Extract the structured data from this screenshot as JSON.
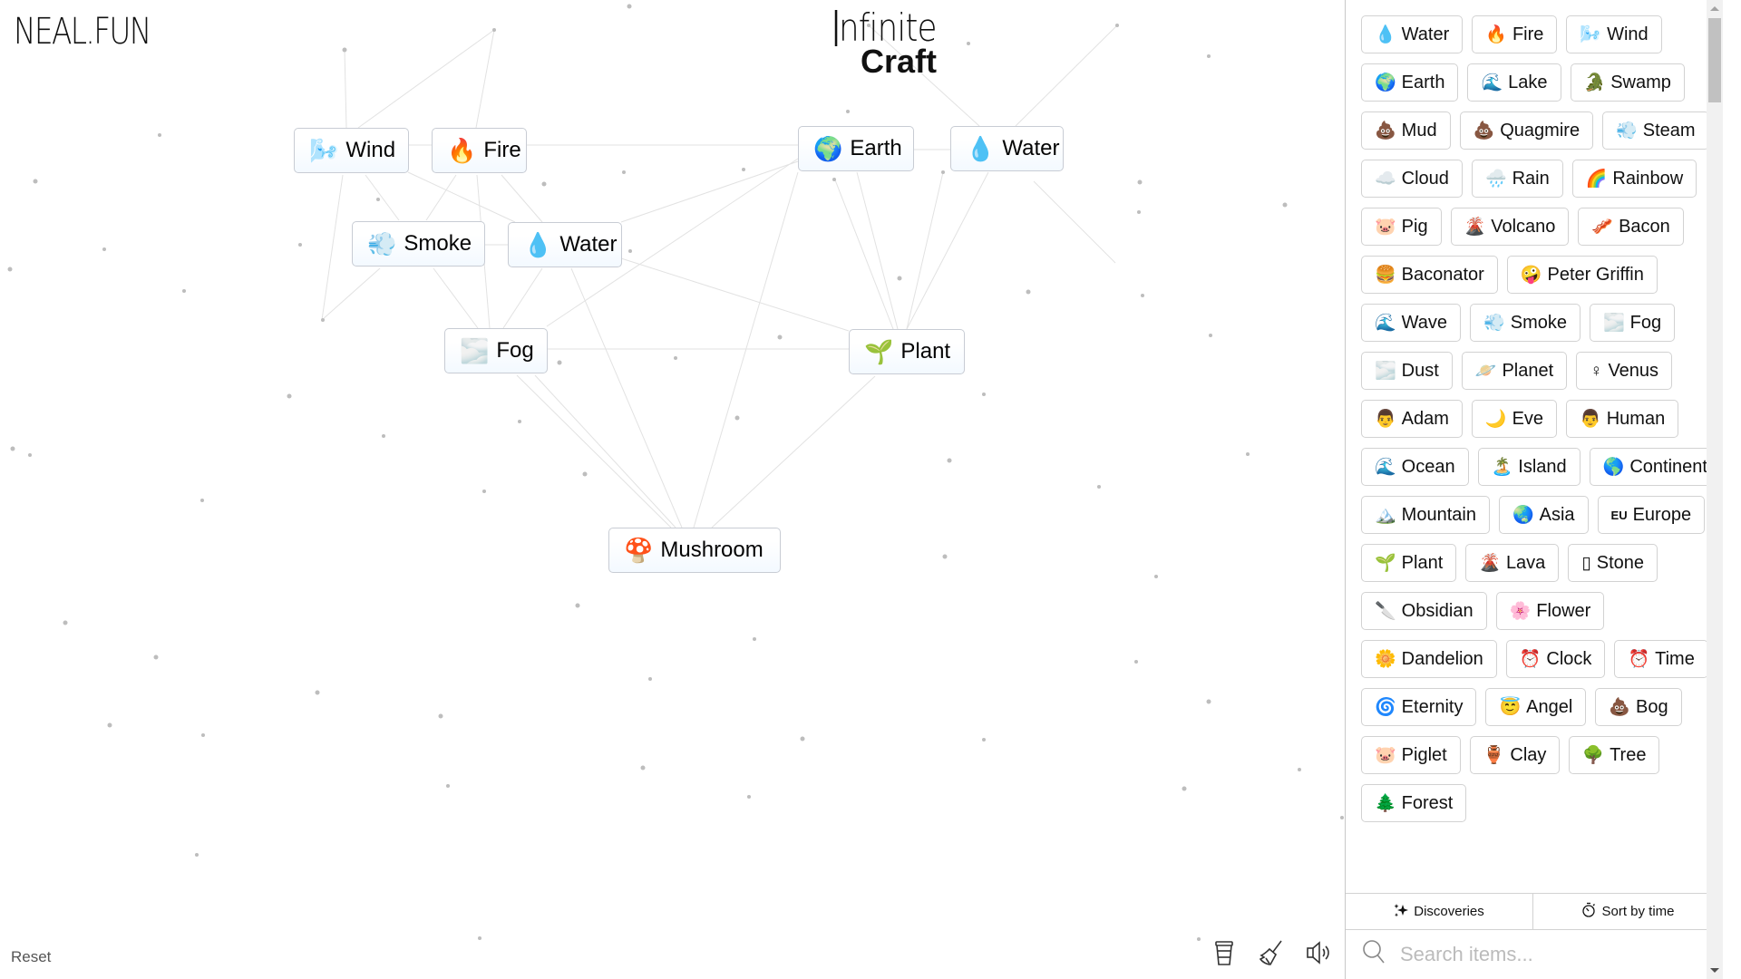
{
  "header": {
    "logo": "NEAL.FUN",
    "title_line1": "nfinite",
    "title_line2": "Craft"
  },
  "canvas": {
    "items": [
      {
        "id": "wind",
        "emoji": "🌬️",
        "label": "Wind"
      },
      {
        "id": "fire",
        "emoji": "🔥",
        "label": "Fire"
      },
      {
        "id": "smoke",
        "emoji": "💨",
        "label": "Smoke"
      },
      {
        "id": "water1",
        "emoji": "💧",
        "label": "Water"
      },
      {
        "id": "fog",
        "emoji": "🌫️",
        "label": "Fog"
      },
      {
        "id": "earth",
        "emoji": "🌍",
        "label": "Earth"
      },
      {
        "id": "water2",
        "emoji": "💧",
        "label": "Water"
      },
      {
        "id": "plant",
        "emoji": "🌱",
        "label": "Plant"
      },
      {
        "id": "mushroom",
        "emoji": "🍄",
        "label": "Mushroom"
      }
    ],
    "reset_label": "Reset",
    "tools": [
      {
        "name": "coffee-cup-icon",
        "glyph": "☕"
      },
      {
        "name": "broom-icon",
        "glyph": "🧹"
      },
      {
        "name": "speaker-icon",
        "glyph": "🔈"
      }
    ]
  },
  "sidebar": {
    "items": [
      {
        "emoji": "💧",
        "label": "Water"
      },
      {
        "emoji": "🔥",
        "label": "Fire"
      },
      {
        "emoji": "🌬️",
        "label": "Wind"
      },
      {
        "emoji": "🌍",
        "label": "Earth"
      },
      {
        "emoji": "🌊",
        "label": "Lake"
      },
      {
        "emoji": "🐊",
        "label": "Swamp"
      },
      {
        "emoji": "💩",
        "label": "Mud"
      },
      {
        "emoji": "💩",
        "label": "Quagmire"
      },
      {
        "emoji": "💨",
        "label": "Steam"
      },
      {
        "emoji": "☁️",
        "label": "Cloud"
      },
      {
        "emoji": "🌧️",
        "label": "Rain"
      },
      {
        "emoji": "🌈",
        "label": "Rainbow"
      },
      {
        "emoji": "🐷",
        "label": "Pig"
      },
      {
        "emoji": "🌋",
        "label": "Volcano"
      },
      {
        "emoji": "🥓",
        "label": "Bacon"
      },
      {
        "emoji": "🍔",
        "label": "Baconator"
      },
      {
        "emoji": "🤪",
        "label": "Peter Griffin"
      },
      {
        "emoji": "🌊",
        "label": "Wave"
      },
      {
        "emoji": "💨",
        "label": "Smoke"
      },
      {
        "emoji": "🌫️",
        "label": "Fog"
      },
      {
        "emoji": "🌫️",
        "label": "Dust"
      },
      {
        "emoji": "🪐",
        "label": "Planet"
      },
      {
        "emoji": "♀",
        "label": "Venus"
      },
      {
        "emoji": "👨",
        "label": "Adam"
      },
      {
        "emoji": "🌙",
        "label": "Eve"
      },
      {
        "emoji": "👨",
        "label": "Human"
      },
      {
        "emoji": "🌊",
        "label": "Ocean"
      },
      {
        "emoji": "🏝️",
        "label": "Island"
      },
      {
        "emoji": "🌎",
        "label": "Continent"
      },
      {
        "emoji": "🏔️",
        "label": "Mountain"
      },
      {
        "emoji": "🌏",
        "label": "Asia"
      },
      {
        "emoji": "EU",
        "label": "Europe",
        "small": true
      },
      {
        "emoji": "🌱",
        "label": "Plant"
      },
      {
        "emoji": "🌋",
        "label": "Lava"
      },
      {
        "emoji": "▯",
        "label": "Stone"
      },
      {
        "emoji": "🔪",
        "label": "Obsidian"
      },
      {
        "emoji": "🌸",
        "label": "Flower"
      },
      {
        "emoji": "🌼",
        "label": "Dandelion"
      },
      {
        "emoji": "⏰",
        "label": "Clock"
      },
      {
        "emoji": "⏰",
        "label": "Time"
      },
      {
        "emoji": "🌀",
        "label": "Eternity"
      },
      {
        "emoji": "😇",
        "label": "Angel"
      },
      {
        "emoji": "💩",
        "label": "Bog"
      },
      {
        "emoji": "🐷",
        "label": "Piglet"
      },
      {
        "emoji": "🏺",
        "label": "Clay"
      },
      {
        "emoji": "🌳",
        "label": "Tree"
      },
      {
        "emoji": "🌲",
        "label": "Forest"
      }
    ],
    "tabs": {
      "discoveries": "Discoveries",
      "sort": "Sort by time"
    },
    "search_placeholder": "Search items..."
  }
}
